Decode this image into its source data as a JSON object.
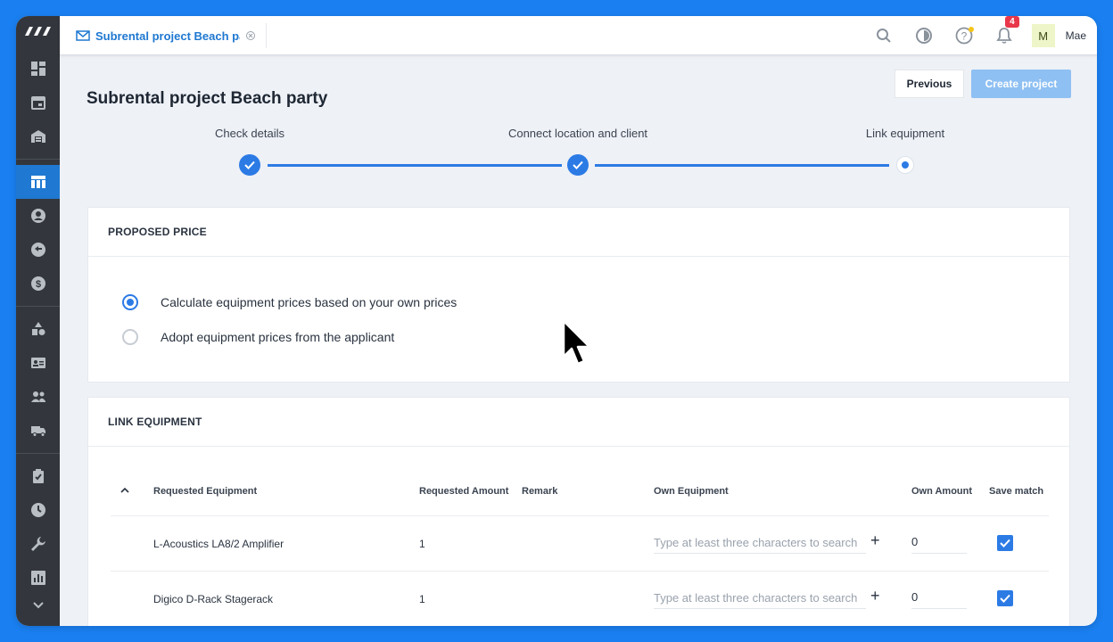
{
  "tab": {
    "title": "Subrental project Beach party"
  },
  "header": {
    "notification_count": "4",
    "user_initial": "M",
    "user_name": "Mae"
  },
  "page": {
    "title": "Subrental project Beach party",
    "previous_label": "Previous",
    "create_label": "Create project"
  },
  "stepper": {
    "steps": [
      {
        "label": "Check details",
        "state": "done"
      },
      {
        "label": "Connect location and client",
        "state": "done"
      },
      {
        "label": "Link equipment",
        "state": "current"
      }
    ]
  },
  "proposed_price": {
    "heading": "PROPOSED PRICE",
    "options": [
      {
        "label": "Calculate equipment prices based on your own prices",
        "selected": true
      },
      {
        "label": "Adopt equipment prices from the applicant",
        "selected": false
      }
    ]
  },
  "link_equipment": {
    "heading": "LINK EQUIPMENT",
    "columns": [
      "Requested Equipment",
      "Requested Amount",
      "Remark",
      "Own Equipment",
      "Own Amount",
      "Save match"
    ],
    "search_placeholder": "Type at least three characters to search",
    "rows": [
      {
        "requested_equipment": "L-Acoustics LA8/2 Amplifier",
        "requested_amount": "1",
        "remark": "",
        "own_amount": "0",
        "save_match": true
      },
      {
        "requested_equipment": "Digico D-Rack Stagerack",
        "requested_amount": "1",
        "remark": "",
        "own_amount": "0",
        "save_match": true
      }
    ]
  },
  "colors": {
    "accent": "#2c7be5",
    "sidebar": "#33373d",
    "background": "#1a7ff0"
  }
}
